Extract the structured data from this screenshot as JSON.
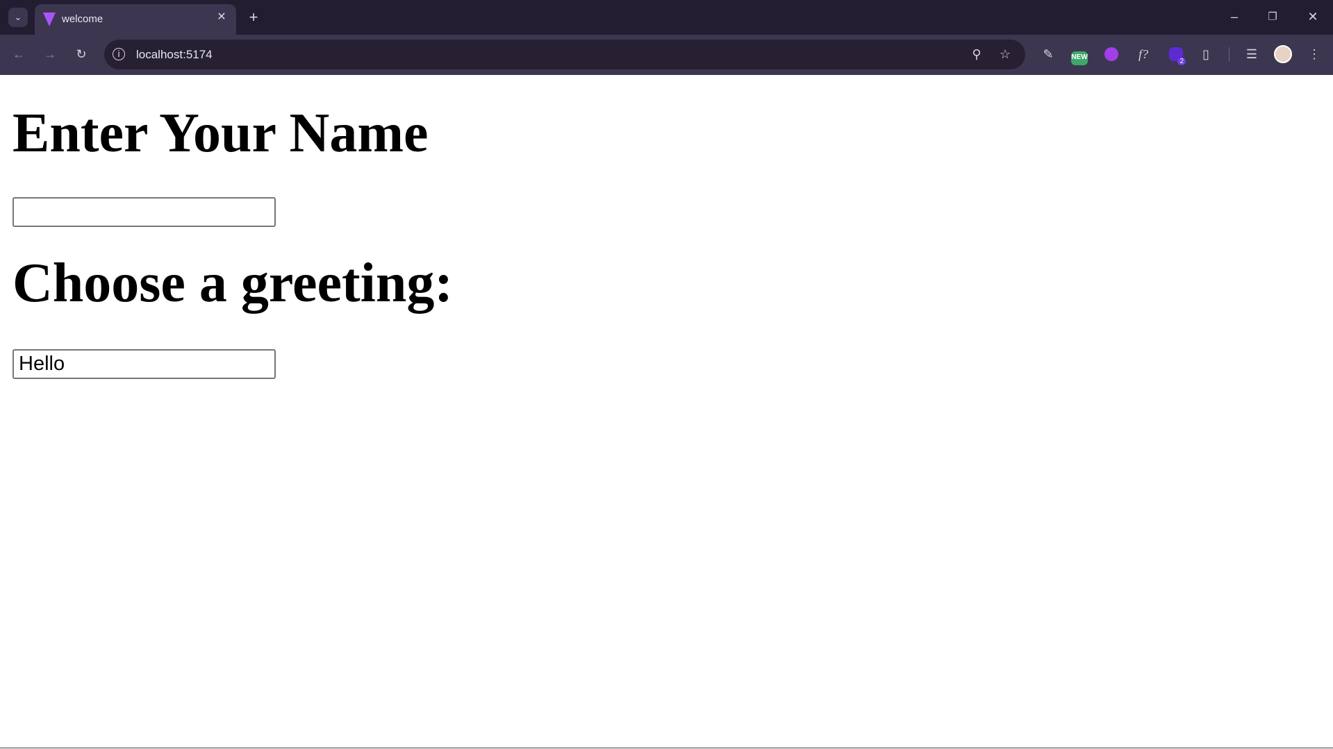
{
  "browser": {
    "tab_title": "welcome",
    "url": "localhost:5174",
    "new_badge": "NEW",
    "ext_badge_count": "2",
    "icons": [
      "tab-search-icon",
      "vite-favicon",
      "close-tab-icon",
      "new-tab-icon",
      "minimize-icon",
      "restore-icon",
      "close-window-icon",
      "back-icon",
      "forward-icon",
      "reload-icon",
      "site-info-icon",
      "zoom-icon",
      "bookmark-star-icon",
      "eyedropper-extension-icon",
      "new-extension-icon",
      "purple-extension-icon",
      "font-extension-icon",
      "badge-extension-icon",
      "extensions-puzzle-icon",
      "media-control-icon",
      "profile-avatar",
      "menu-kebab-icon"
    ]
  },
  "page": {
    "heading1": "Enter Your Name",
    "name_input_value": "",
    "heading2": "Choose a greeting:",
    "greeting_input_value": "Hello"
  }
}
